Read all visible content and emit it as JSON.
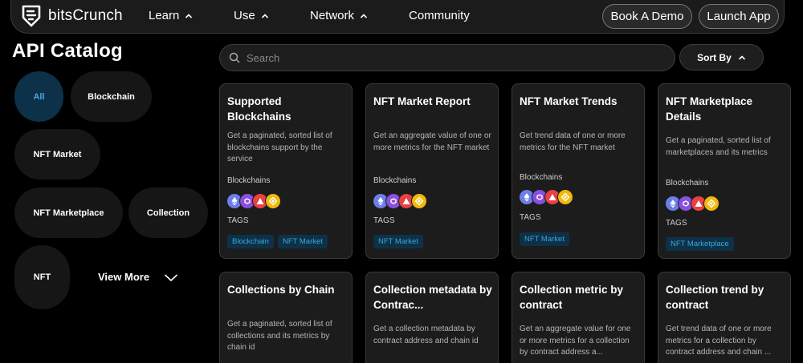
{
  "nav": {
    "brand": "bitsCrunch",
    "items": [
      {
        "label": "Learn",
        "has_chevron": true
      },
      {
        "label": "Use",
        "has_chevron": true
      },
      {
        "label": "Network",
        "has_chevron": true
      },
      {
        "label": "Community",
        "has_chevron": false
      }
    ],
    "book_demo": "Book A Demo",
    "launch_app": "Launch App"
  },
  "page_title": "API Catalog",
  "filters": {
    "all": "All",
    "blockchain": "Blockchain",
    "nft_market": "NFT Market",
    "nft_marketplace": "NFT Marketplace",
    "collection": "Collection",
    "nft": "NFT",
    "view_more": "View More"
  },
  "search": {
    "placeholder": "Search"
  },
  "sort_label": "Sort By",
  "chain_colors": {
    "ethereum": "#6c7fe8",
    "polygon": "#8a4fe0",
    "avalanche": "#e84142",
    "bnb": "#f0b90b"
  },
  "cards": [
    {
      "title": "Supported Blockchains",
      "desc": "Get a paginated, sorted list of blockchains support by the service",
      "chains_label": "Blockchains",
      "tags_label": "TAGS",
      "tags": [
        "Blockchain",
        "NFT Market"
      ]
    },
    {
      "title": "NFT Market Report",
      "desc": "Get an aggregate value of one or more metrics for the NFT market",
      "chains_label": "Blockchains",
      "tags_label": "TAGS",
      "tags": [
        "NFT Market"
      ]
    },
    {
      "title": "NFT Market Trends",
      "desc": "Get trend data of one or more metrics for the NFT market",
      "chains_label": "Blockchains",
      "tags_label": "TAGS",
      "tags": [
        "NFT Market"
      ]
    },
    {
      "title": "NFT Marketplace Details",
      "desc": "Get a paginated, sorted list of marketplaces and its metrics",
      "chains_label": "Blockchains",
      "tags_label": "TAGS",
      "tags": [
        "NFT Marketplace"
      ]
    },
    {
      "title": "Collections by Chain",
      "desc": "Get a paginated, sorted list of collections and its metrics by chain id"
    },
    {
      "title": "Collection metadata by Contrac...",
      "desc": "Get a collection metadata by contract address and chain id"
    },
    {
      "title": "Collection metric by contract",
      "desc": "Get an aggregate value for one or more metrics for a collection by contract address a..."
    },
    {
      "title": "Collection trend by contract",
      "desc": "Get trend data of one or more metrics for a collection by contract address and chain ..."
    }
  ]
}
